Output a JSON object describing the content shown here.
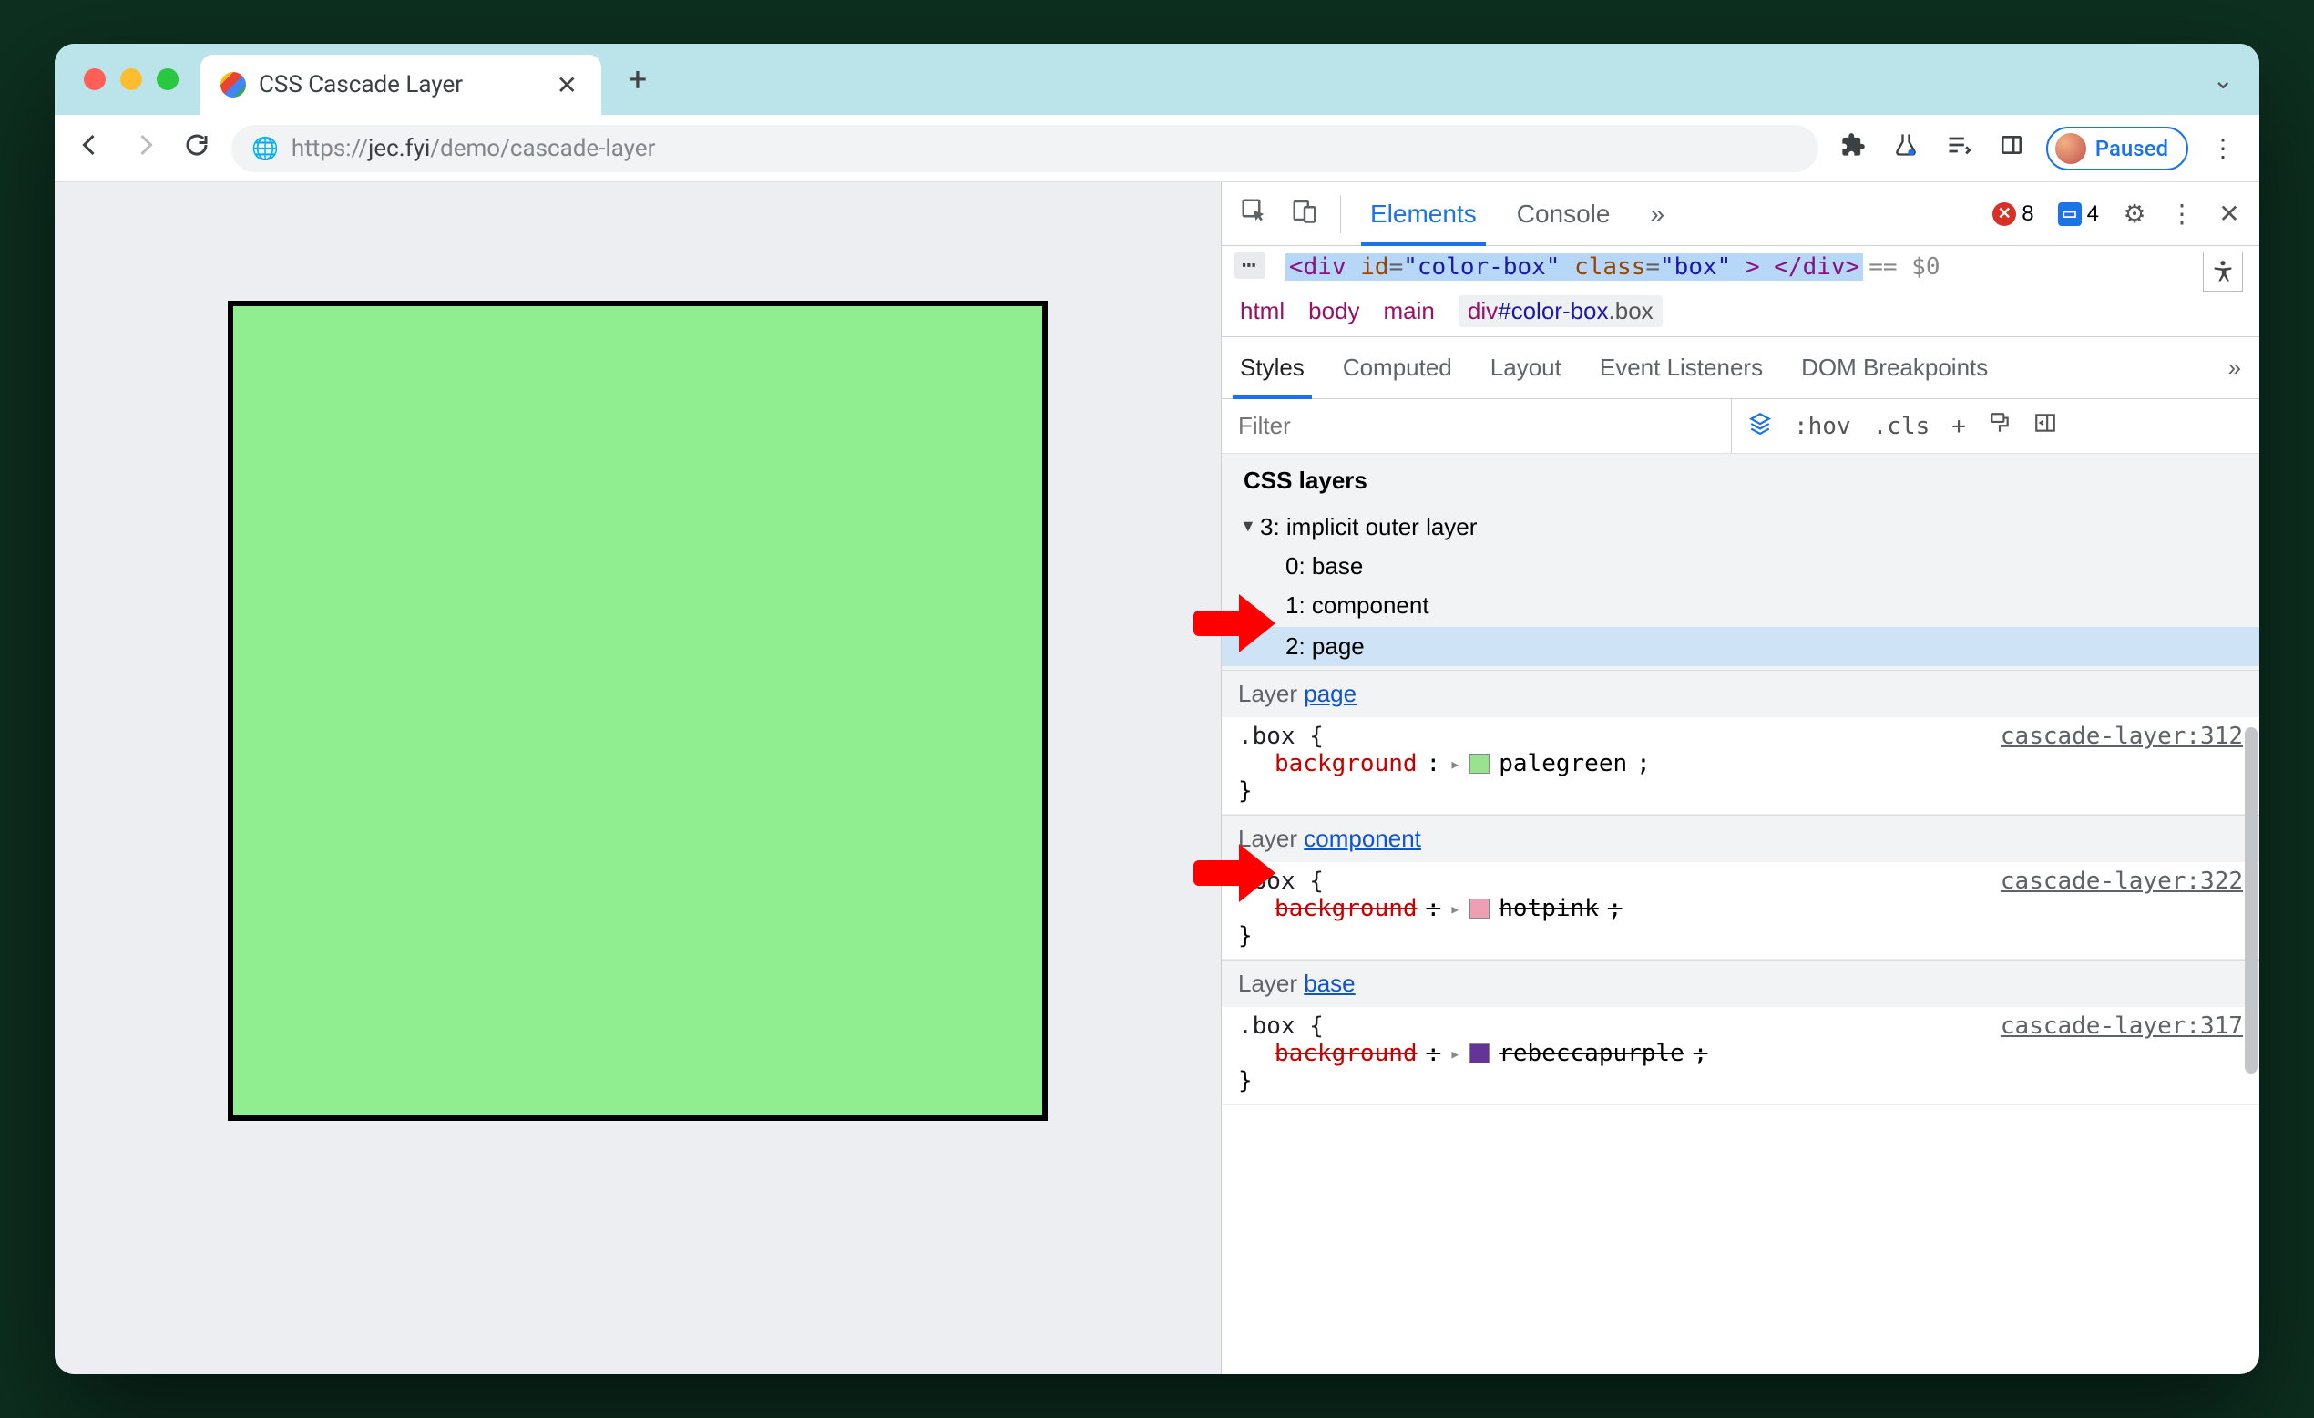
{
  "browser": {
    "tab_title": "CSS Cascade Layer",
    "url_scheme": "https://",
    "url_host": "jec.fyi",
    "url_path": "/demo/cascade-layer",
    "paused_label": "Paused"
  },
  "devtools": {
    "tabs": {
      "elements": "Elements",
      "console": "Console"
    },
    "badges": {
      "errors": "8",
      "info": "4"
    },
    "dom_line": {
      "prefix": "<div ",
      "id_attr": "id",
      "id_val": "\"color-box\"",
      "class_attr": "class",
      "class_val": "\"box\"",
      "suffix": "> </div>",
      "dollar": "== $0"
    },
    "crumb": {
      "html": "html",
      "body": "body",
      "main": "main",
      "sel": "div#color-box.box"
    },
    "subtabs": {
      "styles": "Styles",
      "computed": "Computed",
      "layout": "Layout",
      "events": "Event Listeners",
      "dom": "DOM Breakpoints"
    },
    "filter_placeholder": "Filter",
    "filter_tools": {
      "hov": ":hov",
      "cls": ".cls",
      "plus": "+"
    },
    "layers": {
      "header": "CSS layers",
      "root": "3: implicit outer layer",
      "i0": "0: base",
      "i1": "1: component",
      "i2": "2: page"
    },
    "rules": {
      "page": {
        "layer_prefix": "Layer ",
        "layer_link": "page",
        "selector": ".box {",
        "source": "cascade-layer:312",
        "prop": "background",
        "value": "palegreen",
        "swatch": "#98e38f",
        "close": "}"
      },
      "component": {
        "layer_prefix": "Layer ",
        "layer_link": "component",
        "selector": ".box {",
        "source": "cascade-layer:322",
        "prop": "background",
        "value": "hotpink",
        "swatch": "#eda0b3",
        "close": "}"
      },
      "base": {
        "layer_prefix": "Layer ",
        "layer_link": "base",
        "selector": ".box {",
        "source": "cascade-layer:317",
        "prop": "background",
        "value": "rebeccapurple",
        "swatch": "#663399",
        "close": "}"
      }
    }
  },
  "viewport": {
    "square_color": "#90EE90"
  }
}
